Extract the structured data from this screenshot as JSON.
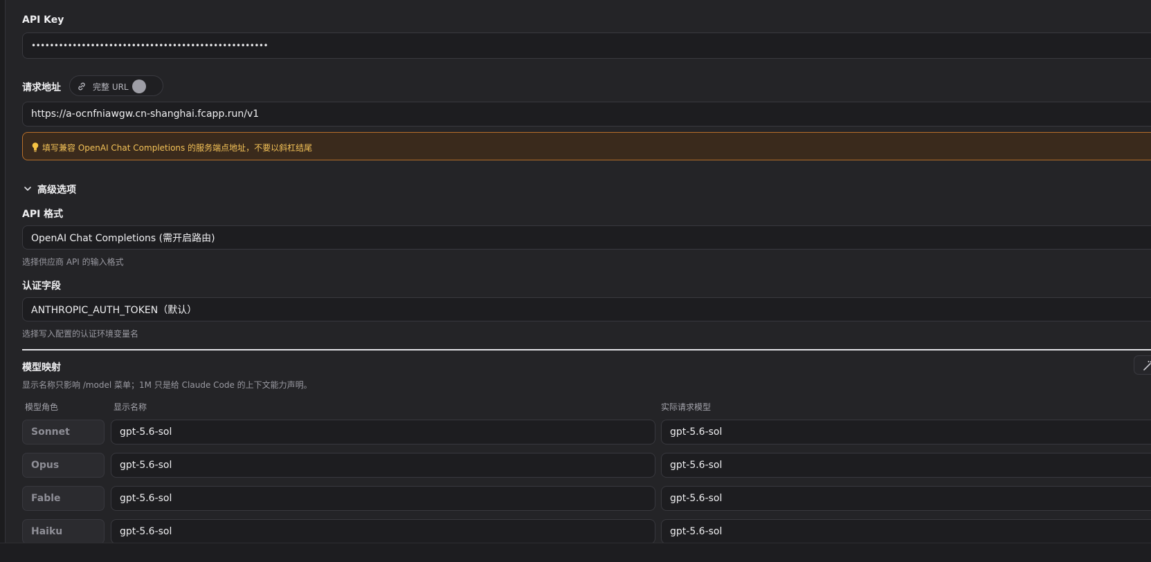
{
  "api_key": {
    "label": "API Key",
    "value": "••••••••••••••••••••••••••••••••••••••••••••••••••••"
  },
  "request_url": {
    "label": "请求地址",
    "full_url_toggle_label": "完整 URL",
    "full_url_enabled": false,
    "value": "https://a-ocnfniawgw.cn-shanghai.fcapp.run/v1",
    "notice": "填写兼容 OpenAI Chat Completions 的服务端点地址，不要以斜杠结尾",
    "notice_color": "#f4c257"
  },
  "advanced": {
    "toggle_label": "高级选项",
    "expanded": true,
    "api_format": {
      "label": "API 格式",
      "selected": "OpenAI Chat Completions (需开启路由)",
      "hint": "选择供应商 API 的输入格式"
    },
    "auth_field": {
      "label": "认证字段",
      "selected": "ANTHROPIC_AUTH_TOKEN（默认）",
      "hint": "选择写入配置的认证环境变量名"
    }
  },
  "model_mapping": {
    "title": "模型映射",
    "description": "显示名称只影响 /model 菜单；1M 只是给 Claude Code 的上下文能力声明。",
    "columns": {
      "role": "模型角色",
      "display_name": "显示名称",
      "actual_model": "实际请求模型"
    },
    "rows": [
      {
        "role": "Sonnet",
        "display_name": "gpt-5.6-sol",
        "actual_model": "gpt-5.6-sol"
      },
      {
        "role": "Opus",
        "display_name": "gpt-5.6-sol",
        "actual_model": "gpt-5.6-sol"
      },
      {
        "role": "Fable",
        "display_name": "gpt-5.6-sol",
        "actual_model": "gpt-5.6-sol"
      },
      {
        "role": "Haiku",
        "display_name": "gpt-5.6-sol",
        "actual_model": "gpt-5.6-sol"
      }
    ],
    "auto_fill_icon": "magic-wand-icon"
  }
}
